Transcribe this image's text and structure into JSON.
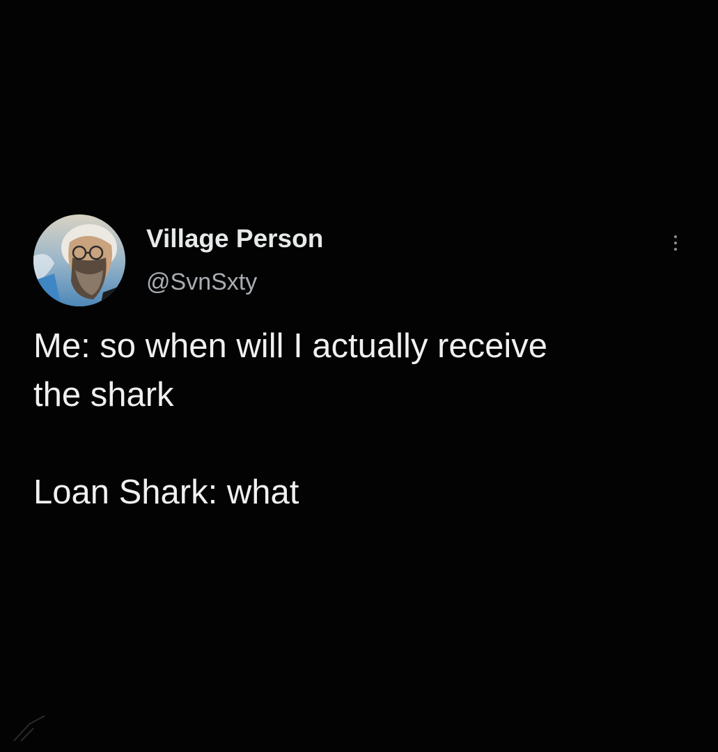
{
  "tweet": {
    "author": {
      "display_name": "Village Person",
      "handle": "@SvnSxty",
      "avatar": "avatar"
    },
    "menu_icon": "more-options-icon",
    "text_lines": [
      "Me: so when will I actually receive",
      "the shark",
      "Loan Shark: what"
    ]
  },
  "colors": {
    "background": "#030303",
    "primary_text": "#e7e9ea",
    "secondary_text": "#a8adb2"
  }
}
